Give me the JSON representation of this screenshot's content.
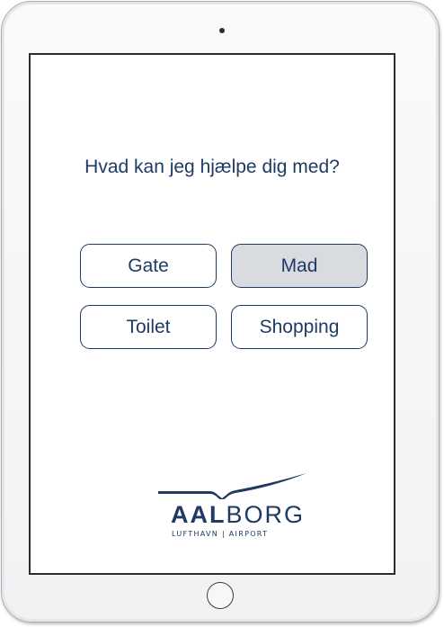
{
  "screen": {
    "question": "Hvad kan jeg hjælpe dig med?",
    "options": [
      {
        "label": "Gate",
        "selected": false
      },
      {
        "label": "Mad",
        "selected": true
      },
      {
        "label": "Toilet",
        "selected": false
      },
      {
        "label": "Shopping",
        "selected": false
      }
    ]
  },
  "logo": {
    "word_bold": "AAL",
    "word_light": "BORG",
    "subtitle": "LUFTHAVN | AIRPORT"
  },
  "colors": {
    "accent": "#1f3a63",
    "selected_bg": "#d8dbe0",
    "device_frame": "#a9adb3"
  }
}
